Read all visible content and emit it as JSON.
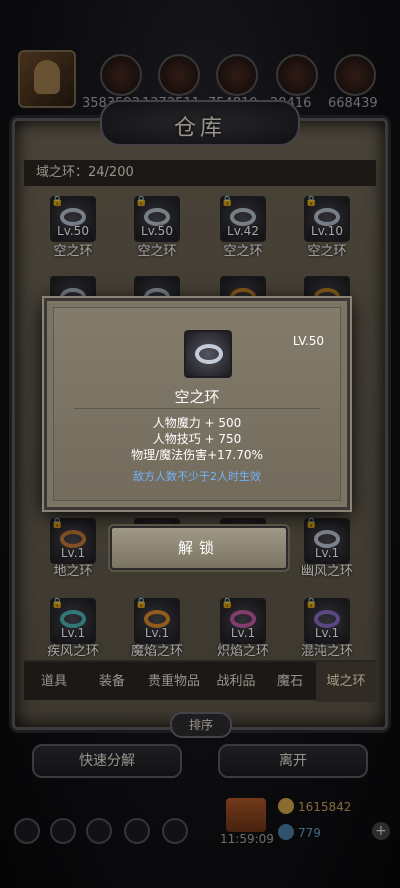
{
  "top": {
    "resources": [
      {
        "icon": "fire-orb-icon",
        "value": "3583593"
      },
      {
        "icon": "wings-icon",
        "value": "1372511"
      },
      {
        "icon": "claw-icon",
        "value": "754819"
      },
      {
        "icon": "crystal-icon",
        "value": "28416"
      },
      {
        "icon": "scythe-icon",
        "value": "668439"
      }
    ]
  },
  "panel": {
    "title": "仓库",
    "slot_count": "域之环：24/200"
  },
  "items_row1": [
    {
      "lv": "Lv.50",
      "name": "空之环"
    },
    {
      "lv": "Lv.50",
      "name": "空之环"
    },
    {
      "lv": "Lv.42",
      "name": "空之环"
    },
    {
      "lv": "Lv.10",
      "name": "空之环"
    }
  ],
  "items_row3": [
    {
      "lv": "Lv.1",
      "name": "地之环"
    },
    {
      "lv": "Lv.1",
      "name": "幽风之环"
    }
  ],
  "items_row4": [
    {
      "lv": "Lv.1",
      "name": "疾风之环"
    },
    {
      "lv": "Lv.1",
      "name": "魔焰之环"
    },
    {
      "lv": "Lv.1",
      "name": "炽焰之环"
    },
    {
      "lv": "Lv.1",
      "name": "混沌之环"
    }
  ],
  "tabs": [
    "道具",
    "装备",
    "贵重物品",
    "战利品",
    "魔石",
    "域之环"
  ],
  "active_tab": "域之环",
  "sort_label": "排序",
  "buttons": {
    "quick_decompose": "快速分解",
    "leave": "离开",
    "unlock": "解锁"
  },
  "popup": {
    "lv": "LV.50",
    "name": "空之环",
    "stats": [
      "人物魔力 + 500",
      "人物技巧 + 750",
      "物理/魔法伤害+17.70%"
    ],
    "condition": "敌方人数不少于2人时生效"
  },
  "hud": {
    "clock": "11:59:09",
    "gold": "1615842",
    "gems": "779"
  },
  "colors": {
    "panel_bg": "#6f6656",
    "condition_text": "#6fb4ff",
    "gold": "#d1a848"
  }
}
